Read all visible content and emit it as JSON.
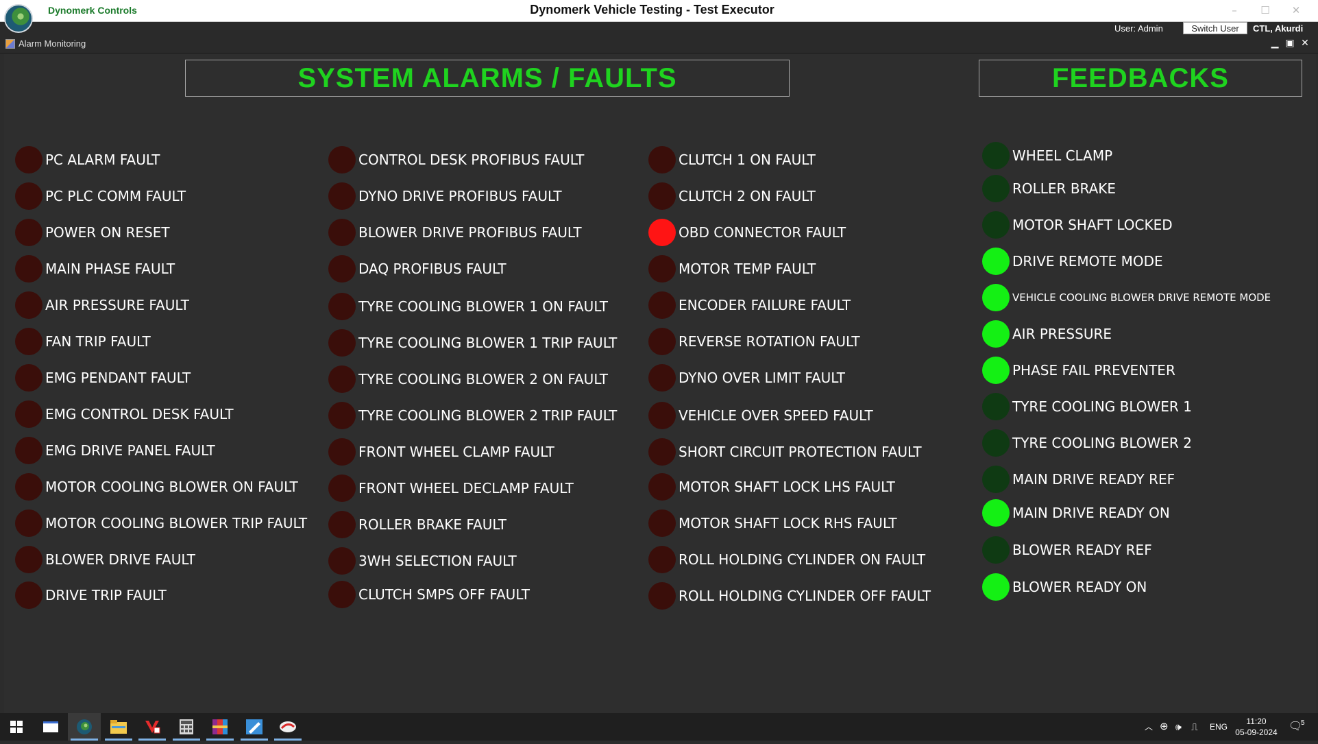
{
  "window": {
    "brand": "Dynomerk Controls",
    "title": "Dynomerk Vehicle Testing - Test Executor",
    "minimize": "–",
    "maximize": "☐",
    "close": "✕"
  },
  "userbar": {
    "user": "User: Admin",
    "switch_user": "Switch User",
    "location": "CTL, Akurdi"
  },
  "child_window": {
    "title": "Alarm Monitoring",
    "minimize": "▁",
    "maximize": "▣",
    "close": "✕"
  },
  "headers": {
    "alarms": "SYSTEM ALARMS / FAULTS",
    "feedbacks": "FEEDBACKS"
  },
  "colors": {
    "fault_off": "#3a0e0a",
    "fault_on": "#ff1414",
    "feedback_off": "#0f3a13",
    "feedback_on": "#14f014",
    "header_text": "#1fd31f"
  },
  "alarms": {
    "col1": [
      {
        "label": "PC ALARM FAULT",
        "active": false
      },
      {
        "label": "PC PLC COMM FAULT",
        "active": false
      },
      {
        "label": "POWER ON RESET",
        "active": false
      },
      {
        "label": "MAIN PHASE FAULT",
        "active": false
      },
      {
        "label": "AIR PRESSURE FAULT",
        "active": false
      },
      {
        "label": "FAN TRIP FAULT",
        "active": false
      },
      {
        "label": "EMG PENDANT FAULT",
        "active": false
      },
      {
        "label": "EMG CONTROL DESK FAULT",
        "active": false
      },
      {
        "label": "EMG DRIVE PANEL FAULT",
        "active": false
      },
      {
        "label": "MOTOR COOLING BLOWER ON FAULT",
        "active": false
      },
      {
        "label": "MOTOR COOLING BLOWER TRIP  FAULT",
        "active": false
      },
      {
        "label": "BLOWER DRIVE FAULT",
        "active": false
      },
      {
        "label": "DRIVE TRIP FAULT",
        "active": false
      }
    ],
    "col2": [
      {
        "label": "CONTROL DESK PROFIBUS FAULT",
        "active": false
      },
      {
        "label": "DYNO DRIVE PROFIBUS FAULT",
        "active": false
      },
      {
        "label": "BLOWER DRIVE PROFIBUS FAULT",
        "active": false
      },
      {
        "label": "DAQ PROFIBUS FAULT",
        "active": false
      },
      {
        "label": "TYRE COOLING BLOWER 1 ON FAULT",
        "active": false
      },
      {
        "label": "TYRE COOLING BLOWER 1 TRIP FAULT",
        "active": false
      },
      {
        "label": "TYRE COOLING BLOWER 2 ON FAULT",
        "active": false
      },
      {
        "label": "TYRE COOLING BLOWER 2 TRIP FAULT",
        "active": false
      },
      {
        "label": "FRONT WHEEL CLAMP FAULT",
        "active": false
      },
      {
        "label": "FRONT WHEEL DECLAMP FAULT",
        "active": false
      },
      {
        "label": "ROLLER BRAKE FAULT",
        "active": false
      },
      {
        "label": "3WH SELECTION FAULT",
        "active": false
      },
      {
        "label": "CLUTCH SMPS OFF FAULT",
        "active": false
      }
    ],
    "col3": [
      {
        "label": "CLUTCH 1 ON FAULT",
        "active": false
      },
      {
        "label": "CLUTCH 2 ON FAULT",
        "active": false
      },
      {
        "label": "OBD CONNECTOR FAULT",
        "active": true
      },
      {
        "label": "MOTOR TEMP FAULT",
        "active": false
      },
      {
        "label": "ENCODER FAILURE FAULT",
        "active": false
      },
      {
        "label": "REVERSE ROTATION FAULT",
        "active": false
      },
      {
        "label": "DYNO OVER LIMIT FAULT",
        "active": false
      },
      {
        "label": "VEHICLE OVER SPEED FAULT",
        "active": false
      },
      {
        "label": "SHORT CIRCUIT PROTECTION  FAULT",
        "active": false
      },
      {
        "label": "MOTOR SHAFT LOCK LHS FAULT",
        "active": false
      },
      {
        "label": "MOTOR SHAFT LOCK RHS FAULT",
        "active": false
      },
      {
        "label": "ROLL HOLDING CYLINDER ON FAULT",
        "active": false
      },
      {
        "label": "ROLL HOLDING CYLINDER OFF FAULT",
        "active": false
      }
    ]
  },
  "feedbacks": [
    {
      "label": "WHEEL CLAMP",
      "active": false
    },
    {
      "label": "ROLLER BRAKE",
      "active": false
    },
    {
      "label": "MOTOR SHAFT LOCKED",
      "active": false
    },
    {
      "label": "DRIVE REMOTE MODE",
      "active": true
    },
    {
      "label": "VEHICLE COOLING BLOWER DRIVE REMOTE MODE",
      "active": true
    },
    {
      "label": "AIR PRESSURE",
      "active": true
    },
    {
      "label": "PHASE FAIL PREVENTER",
      "active": true
    },
    {
      "label": "TYRE COOLING BLOWER 1",
      "active": false
    },
    {
      "label": "TYRE COOLING BLOWER 2",
      "active": false
    },
    {
      "label": "MAIN DRIVE READY REF",
      "active": false
    },
    {
      "label": "MAIN DRIVE READY ON",
      "active": true
    },
    {
      "label": "BLOWER READY REF",
      "active": false
    },
    {
      "label": "BLOWER READY ON",
      "active": true
    }
  ],
  "taskbar": {
    "apps": [
      {
        "icon": "windows-start-icon"
      },
      {
        "icon": "desktop-window-icon"
      },
      {
        "icon": "dynomerk-app-icon"
      },
      {
        "icon": "file-explorer-icon"
      },
      {
        "icon": "v-app-icon"
      },
      {
        "icon": "calculator-app-icon"
      },
      {
        "icon": "winrar-icon"
      },
      {
        "icon": "paint-app-icon"
      },
      {
        "icon": "racing-app-icon"
      }
    ],
    "language": "ENG",
    "time": "11:20",
    "date": "05-09-2024",
    "notifications": "5"
  }
}
